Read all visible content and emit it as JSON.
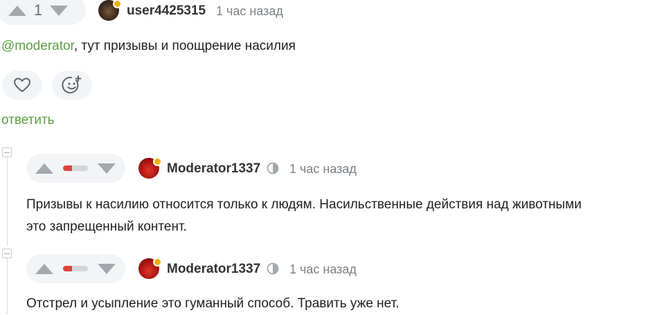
{
  "comment": {
    "score": "1",
    "username": "user4425315",
    "time": "1 час назад",
    "mention": "@moderator",
    "text": ", тут призывы и поощрение насилия",
    "reply_label": "ответить",
    "icons": {
      "like": "heart-icon",
      "reaction": "emoji-add-icon"
    }
  },
  "replies": [
    {
      "username": "Moderator1337",
      "time": "1 час назад",
      "rating_fraction": 0.35,
      "lines": [
        "Призывы к насилию относится только к людям. Насильственные действия над животными",
        "это запрещенный контент."
      ]
    },
    {
      "username": "Moderator1337",
      "time": "1 час назад",
      "rating_fraction": 0.35,
      "lines": [
        "Отстрел и усыпление это гуманный способ. Травить уже нет."
      ]
    }
  ],
  "colors": {
    "accent_green": "#5c9e43",
    "downvote_red": "#d7463d",
    "online_dot": "#f0b100"
  }
}
